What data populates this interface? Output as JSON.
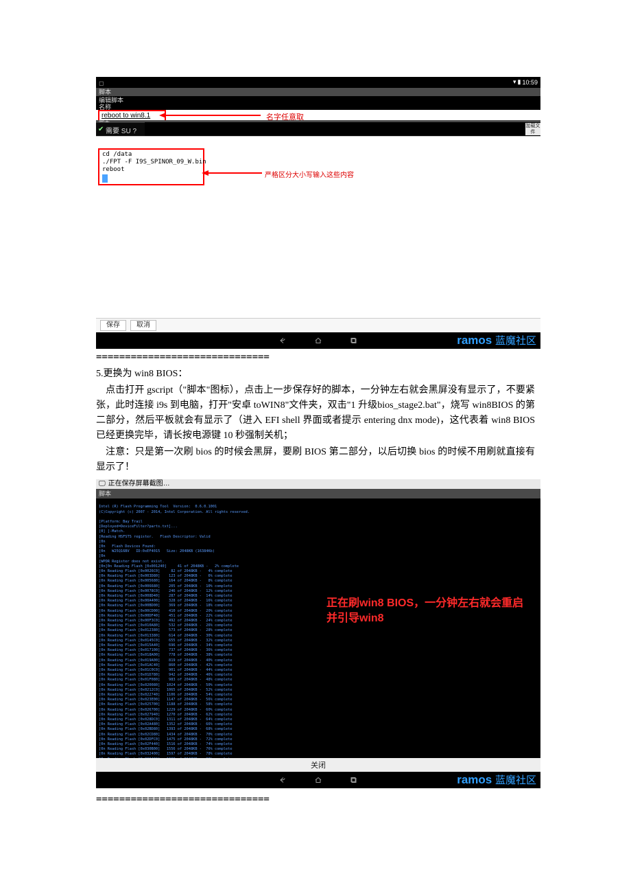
{
  "shot1": {
    "statusbar": {
      "time": "10:59"
    },
    "title1": "脚本",
    "title2_line1": "编辑脚本",
    "title2_line2": "名称",
    "name_field": "reboot to win8.1",
    "arrow1_label": "名字任意取",
    "rowtop": "脚本",
    "su_row": "需要 SU ?",
    "right_button": "加载文件",
    "script_lines": "cd /data\n./FPT -F I9S_SPINOR_09_W.bin\nreboot",
    "arrow2_label": "严格区分大小写输入这些内容",
    "save_label": "保存",
    "cancel_label": "取消",
    "brand": "ramos",
    "brand_cn": "蓝魔社区"
  },
  "divider": "==============================",
  "body": {
    "h5": "5.更换为 win8 BIOS：",
    "p1": "点击打开 gscript（\"脚本\"图标），点击上一步保存好的脚本，一分钟左右就会黑屏没有显示了，不要紧张，此时连接 i9s 到电脑，打开\"安卓 toWIN8\"文件夹，双击\"1 升级bios_stage2.bat\"，烧写 win8BIOS 的第二部分，然后平板就会有显示了（进入 EFI shell 界面或者提示 entering dnx mode)，这代表着 win8 BIOS 已经更换完毕，请长按电源键 10 秒强制关机；",
    "p2": "注意：只是第一次刷 bios 的时候会黑屏，要刷 BIOS 第二部分，以后切换 bios 的时候不用刷就直接有显示了！"
  },
  "shot2": {
    "wtitle": "正在保存屏幕截图…",
    "tab": "脚本",
    "overlay": "正在刷win8 BIOS，一分钟左右就会重启并引导win8",
    "close": "关闭",
    "brand": "ramos",
    "brand_cn": "蓝魔社区",
    "term_header": "Intel (R) Flash Programming Tool  Version:  0.6.0.1001\n(C)Copyright (c) 2007 - 2014, Intel Corporation. All rights reserved.\n\n[Platform: Bay Trail\n[Deployed=DeviceFilter?parts.txt]...\n[0] [-Match.\n[Reading HSFSTS register.   Flash Descriptor: Valid\n[0n\n[0n   Flash Devices Found:\n[0n   W25Q16BV   ID:0xEF4015   Size: 2048KB (16384Kb)\n[0n\n[WPDR Register does not exist.\n[0n",
    "term_progress_label": "Reading Flash",
    "term_progress_unit": "KB",
    "term_progress_suffix": "complete"
  }
}
